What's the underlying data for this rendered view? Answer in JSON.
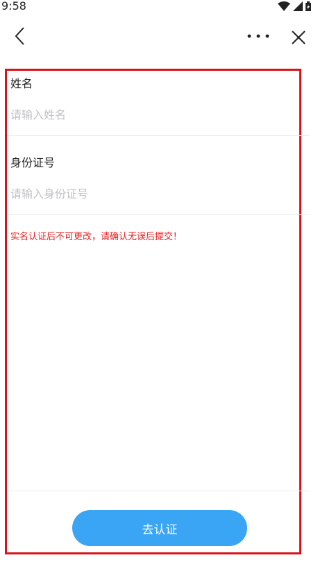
{
  "status_bar": {
    "time": "9:58"
  },
  "nav": {
    "back_icon": "chevron-left-icon",
    "more_icon": "more-dots-icon",
    "close_icon": "close-icon"
  },
  "form": {
    "name_label": "姓名",
    "name_placeholder": "请输入姓名",
    "name_value": "",
    "id_label": "身份证号",
    "id_placeholder": "请输入身份证号",
    "id_value": "",
    "notice": "实名认证后不可更改，请确认无误后提交！",
    "submit_label": "去认证"
  },
  "colors": {
    "accent": "#3aa4f5",
    "notice": "#e81d1d",
    "frame": "#d8121a",
    "placeholder": "#c0c0c6"
  }
}
